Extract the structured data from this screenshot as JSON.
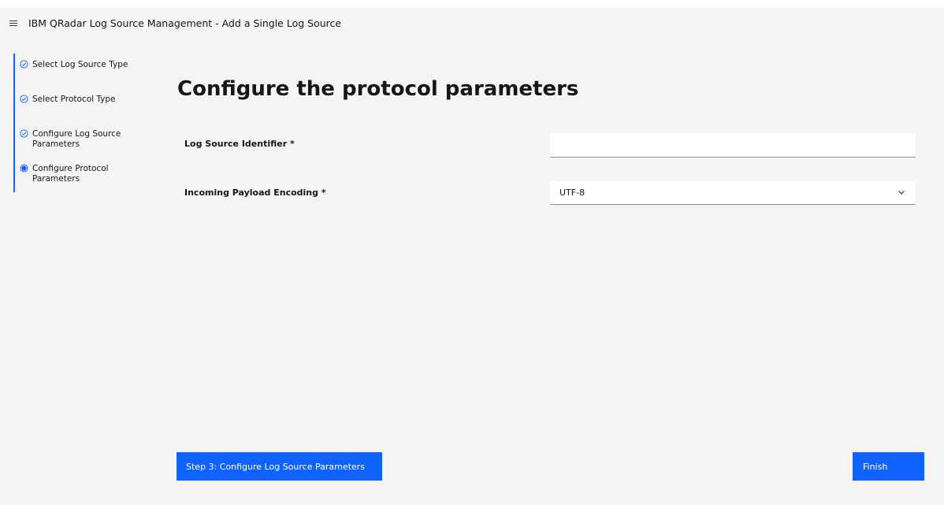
{
  "header": {
    "title": "IBM QRadar Log Source Management - Add a Single Log Source"
  },
  "steps": [
    {
      "label": "Select Log Source Type",
      "state": "complete"
    },
    {
      "label": "Select Protocol Type",
      "state": "complete"
    },
    {
      "label": "Configure Log Source Parameters",
      "state": "complete"
    },
    {
      "label": "Configure Protocol Parameters",
      "state": "current"
    }
  ],
  "main": {
    "heading": "Configure the protocol parameters",
    "fields": {
      "identifier_label": "Log Source Identifier *",
      "identifier_value": "",
      "encoding_label": "Incoming Payload Encoding *",
      "encoding_value": "UTF-8"
    }
  },
  "footer": {
    "back_label": "Step 3: Configure Log Source Parameters",
    "finish_label": "Finish"
  },
  "colors": {
    "accent": "#0f62fe",
    "background": "#f4f4f4"
  },
  "icons": {
    "menu": "hamburger-menu-icon",
    "complete_step": "checkmark-outline-icon",
    "current_step": "radio-filled-icon",
    "dropdown": "chevron-down-icon"
  }
}
